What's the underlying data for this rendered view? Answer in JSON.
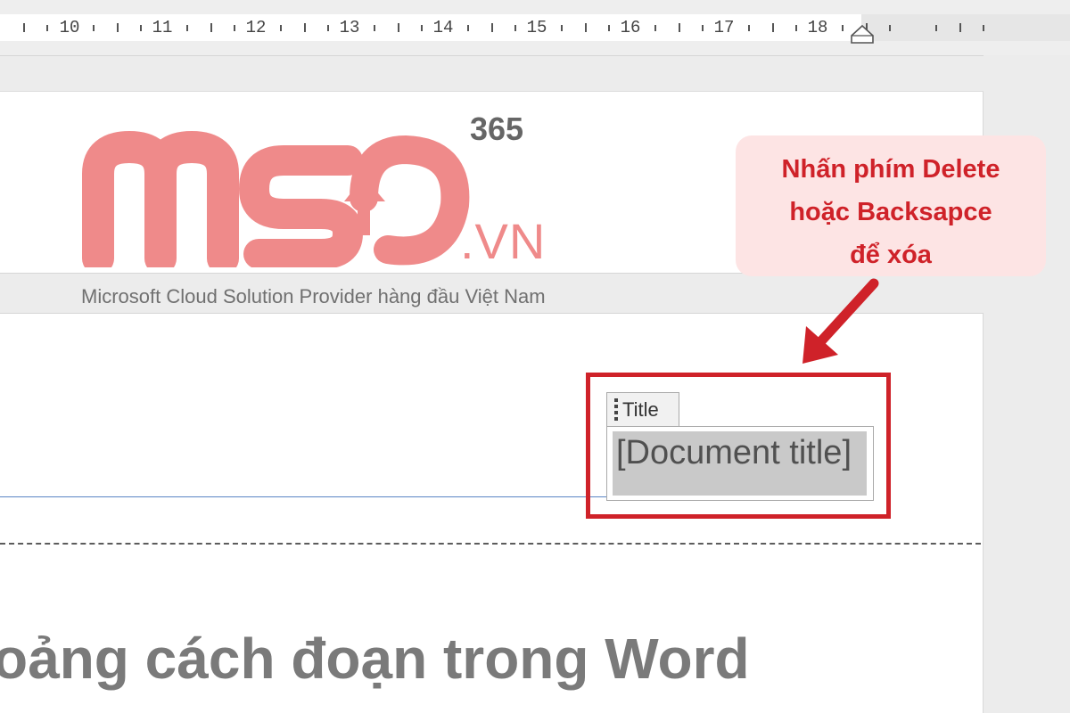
{
  "ruler": {
    "numbers": [
      "10",
      "11",
      "12",
      "13",
      "14",
      "15",
      "16",
      "17",
      "18"
    ]
  },
  "logo": {
    "brand": "MSO",
    "superscript": "365",
    "domain": ".VN",
    "tagline": "Microsoft Cloud Solution Provider hàng đầu Việt Nam",
    "brand_color": "#ef8a8a"
  },
  "header_field": {
    "tab_label": "Title",
    "placeholder_text": "[Document title]"
  },
  "callout": {
    "lines": [
      "Nhấn phím Delete",
      "hoặc Backsapce",
      "để xóa"
    ],
    "text_color": "#cf2229",
    "background": "#fde4e4"
  },
  "document": {
    "heading_fragment": "oảng cách đoạn trong Word"
  },
  "colors": {
    "accent_red": "#cf2229",
    "header_rule_blue": "#5a86c5"
  }
}
